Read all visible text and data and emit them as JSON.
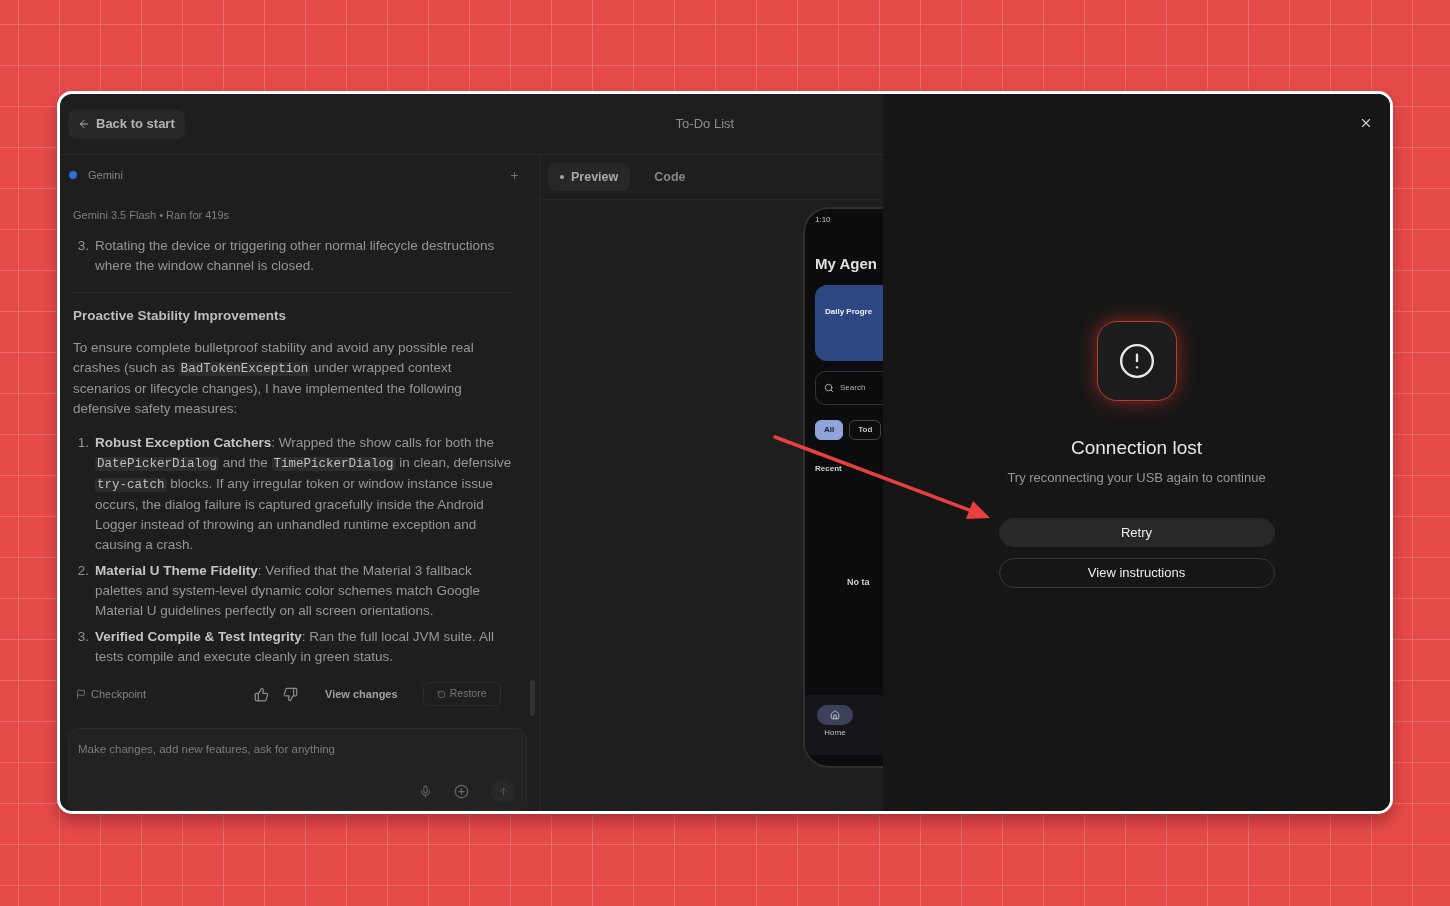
{
  "header": {
    "back_button": "Back to start",
    "title": "To-Do List"
  },
  "chat": {
    "agent": "Gemini",
    "meta": "Gemini 3.5 Flash • Ran for 419s",
    "blocks": [
      {
        "kind": "list_item",
        "number": "3.",
        "segments": [
          {
            "kind": "text",
            "text": "Rotating the device or triggering other normal lifecycle destructions where the window channel is closed."
          }
        ]
      },
      {
        "kind": "heading",
        "text": "Proactive Stability Improvements"
      },
      {
        "kind": "paragraph",
        "segments": [
          {
            "kind": "text",
            "text": "To ensure complete bulletproof stability and avoid any possible real crashes (such as "
          },
          {
            "kind": "code",
            "text": "BadTokenException"
          },
          {
            "kind": "text",
            "text": " under wrapped context scenarios or lifecycle changes), I have implemented the following defensive safety measures:"
          }
        ]
      },
      {
        "kind": "list_item",
        "number": "1.",
        "segments": [
          {
            "kind": "bold",
            "text": "Robust Exception Catchers"
          },
          {
            "kind": "text",
            "text": ": Wrapped the show calls for both the "
          },
          {
            "kind": "code",
            "text": "DatePickerDialog"
          },
          {
            "kind": "text",
            "text": " and the "
          },
          {
            "kind": "code",
            "text": "TimePickerDialog"
          },
          {
            "kind": "text",
            "text": " in clean, defensive "
          },
          {
            "kind": "code",
            "text": "try-catch"
          },
          {
            "kind": "text",
            "text": " blocks. If any irregular token or window instance issue occurs, the dialog failure is captured gracefully inside the Android Logger instead of throwing an unhandled runtime exception and causing a crash."
          }
        ]
      },
      {
        "kind": "list_item",
        "number": "2.",
        "segments": [
          {
            "kind": "bold",
            "text": "Material U Theme Fidelity"
          },
          {
            "kind": "text",
            "text": ": Verified that the Material 3 fallback palettes and system-level dynamic color schemes match Google Material U guidelines perfectly on all screen orientations."
          }
        ]
      },
      {
        "kind": "list_item",
        "number": "3.",
        "segments": [
          {
            "kind": "bold",
            "text": "Verified Compile & Test Integrity"
          },
          {
            "kind": "text",
            "text": ": Ran the full local JVM suite. All tests compile and execute cleanly in green status."
          }
        ]
      }
    ],
    "actions": {
      "checkpoint": "Checkpoint",
      "view_changes": "View changes",
      "restore": {
        "label": "Restore",
        "disabled": true
      }
    },
    "composer": {
      "placeholder": "Make changes, add new features, ask for anything"
    }
  },
  "preview": {
    "tabs": [
      {
        "label": "Preview",
        "selected": true
      },
      {
        "label": "Code",
        "selected": false
      }
    ],
    "phone": {
      "status_time": "1:10",
      "title": "My Agen",
      "card_title": "Daily Progre",
      "search_placeholder": "Search",
      "chips": [
        {
          "label": "All",
          "selected": true
        },
        {
          "label": "Tod",
          "selected": false
        }
      ],
      "section": "Recent",
      "empty_title": "No ta",
      "nav": [
        {
          "label": "Home",
          "selected": true
        }
      ]
    }
  },
  "dialog": {
    "title": "Connection lost",
    "message": "Try reconnecting your USB again to continue",
    "buttons": [
      {
        "label": "Retry",
        "kind": "filled"
      },
      {
        "label": "View instructions",
        "kind": "outline"
      }
    ]
  }
}
